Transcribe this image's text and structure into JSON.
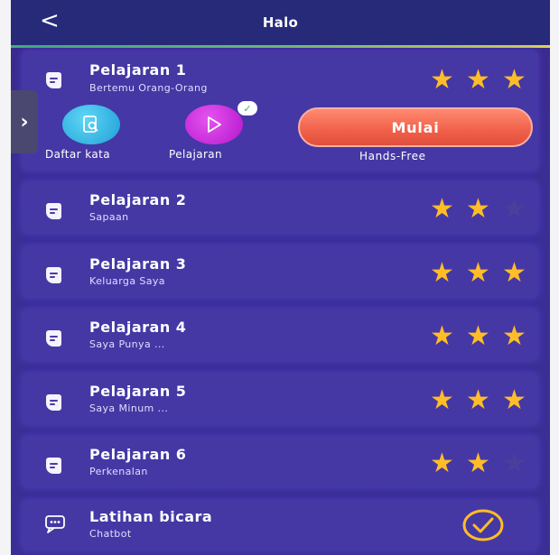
{
  "header": {
    "title": "Halo",
    "back_icon": "chevron-left-icon"
  },
  "side_tab": {
    "icon": "chevron-right-icon"
  },
  "lessons": [
    {
      "title": "Pelajaran 1",
      "subtitle": "Bertemu Orang-Orang",
      "stars": 3,
      "expanded": true
    },
    {
      "title": "Pelajaran 2",
      "subtitle": "Sapaan",
      "stars": 2
    },
    {
      "title": "Pelajaran 3",
      "subtitle": "Keluarga Saya",
      "stars": 3
    },
    {
      "title": "Pelajaran 4",
      "subtitle": "Saya Punya ...",
      "stars": 3
    },
    {
      "title": "Pelajaran 5",
      "subtitle": "Saya Minum ...",
      "stars": 3
    },
    {
      "title": "Pelajaran 6",
      "subtitle": "Perkenalan",
      "stars": 2
    }
  ],
  "expanded_actions": {
    "vocab_label": "Daftar kata",
    "lesson_label": "Pelajaran",
    "start_label": "Mulai",
    "hands_free_label": "Hands-Free"
  },
  "practice": {
    "title": "Latihan bicara",
    "subtitle": "Chatbot",
    "completed": true
  },
  "colors": {
    "header": "#262a78",
    "background": "#3b2f96",
    "star": "#ffbd27",
    "start_button": "#f0604a",
    "vocab_button": "#30b6e6",
    "lesson_button": "#c828dc"
  }
}
